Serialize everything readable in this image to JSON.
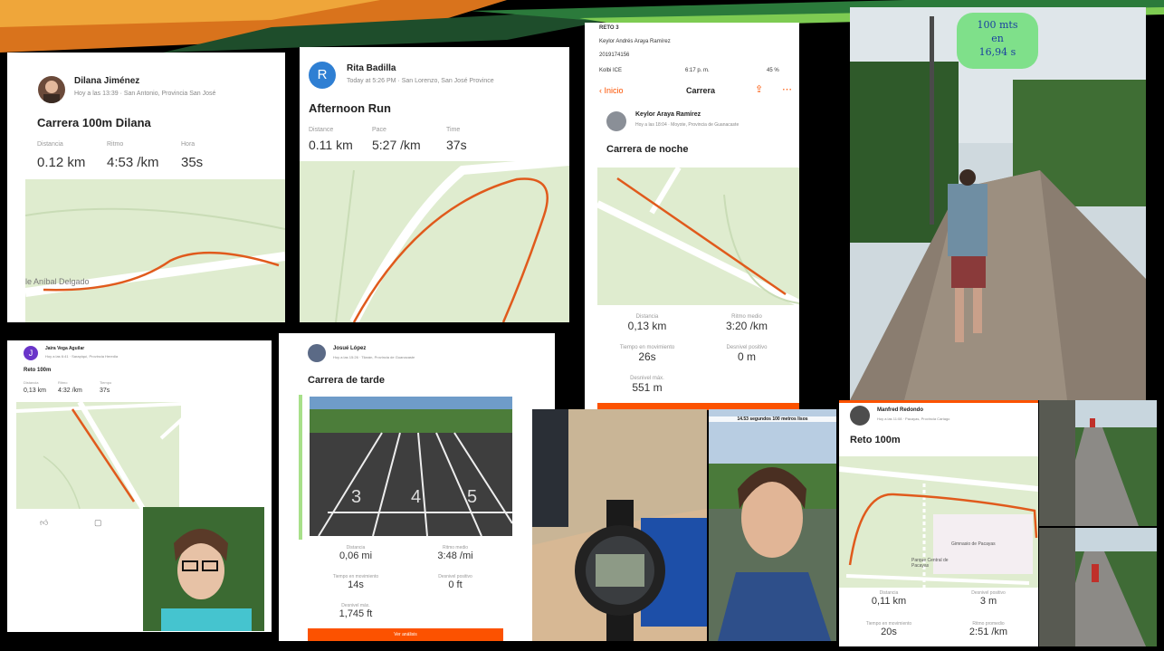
{
  "brand": {
    "strava_orange": "#fc5200",
    "map_green": "#dfeccf",
    "route": "#e05a1c"
  },
  "card_dilana": {
    "name": "Dilana Jiménez",
    "sub": "Hoy a las 13:39 · San Antonio, Provincia San José",
    "title": "Carrera 100m Dilana",
    "stats": [
      {
        "label": "Distancia",
        "value": "0.12 km"
      },
      {
        "label": "Ritmo",
        "value": "4:53 /km"
      },
      {
        "label": "Hora",
        "value": "35s"
      }
    ],
    "street": "le Aníbal Delgado"
  },
  "card_rita": {
    "avatar_letter": "R",
    "name": "Rita Badilla",
    "sub": "Today at 5:26 PM · San Lorenzo, San José Province",
    "title": "Afternoon Run",
    "stats": [
      {
        "label": "Distance",
        "value": "0.11 km"
      },
      {
        "label": "Pace",
        "value": "5:27 /km"
      },
      {
        "label": "Time",
        "value": "37s"
      }
    ]
  },
  "card_keylor": {
    "header_line1": "RETO 3",
    "header_line2": "Keylor Andrés Araya Ramírez",
    "header_line3": "2019174156",
    "status": {
      "carrier": "Kolbi ICE",
      "time": "6:17 p. m.",
      "battery": "45 %"
    },
    "nav": {
      "back": "Inicio",
      "title": "Carrera"
    },
    "name": "Keylor Araya Ramírez",
    "sub": "Hoy a las 18:04 · Moyote, Provincia de Guanacaste",
    "title": "Carrera de noche",
    "stats": [
      {
        "label": "Distancia",
        "value": "0,13 km"
      },
      {
        "label": "Ritmo medio",
        "value": "3:20 /km"
      },
      {
        "label": "Tiempo en movimiento",
        "value": "26s"
      },
      {
        "label": "Desnivel positivo",
        "value": "0 m"
      },
      {
        "label": "Desnivel máx.",
        "value": "551 m"
      }
    ]
  },
  "photo_road": {
    "annotation_line1": "100 mts",
    "annotation_line2": "en",
    "annotation_line3": "16,94 s"
  },
  "card_jaira": {
    "avatar_letter": "J",
    "name": "Jaira Vega Aguilar",
    "sub": "Hoy a las 6:41 · Sarapiquí, Provincia Heredia",
    "title": "Reto 100m",
    "stats": [
      {
        "label": "Distancia",
        "value": "0,13 km"
      },
      {
        "label": "Ritmo",
        "value": "4:32 /km"
      },
      {
        "label": "Tiempo",
        "value": "37s"
      }
    ]
  },
  "card_josue": {
    "name": "Josué López",
    "sub": "Hoy a las 15:26 · Tilarán, Provincia de Guanacaste",
    "title": "Carrera de tarde",
    "track_numbers": [
      "3",
      "4",
      "5"
    ],
    "stats": [
      {
        "label": "Distancia",
        "value": "0,06 mi"
      },
      {
        "label": "Ritmo medio",
        "value": "3:48 /mi"
      },
      {
        "label": "Tiempo en movimiento",
        "value": "14s"
      },
      {
        "label": "Desnivel positivo",
        "value": "0 ft"
      },
      {
        "label": "Desnivel máx.",
        "value": "1,745 ft"
      }
    ],
    "button": "Ver análisis"
  },
  "photo_selfie2": {
    "caption": "14.53 segundos 100 metros lisos"
  },
  "card_manfred": {
    "name": "Manfred Redondo",
    "sub": "Hoy a las 11:08 · Pacayas, Provincia Cartago",
    "title": "Reto 100m",
    "map_labels": [
      "Gimnasio de Pacayas",
      "Parque Central de Pacayas"
    ],
    "stats": [
      {
        "label": "Distancia",
        "value": "0,11 km"
      },
      {
        "label": "Desnivel positivo",
        "value": "3 m"
      },
      {
        "label": "Tiempo en movimiento",
        "value": "20s"
      },
      {
        "label": "Ritmo promedio",
        "value": "2:51 /km"
      }
    ]
  }
}
